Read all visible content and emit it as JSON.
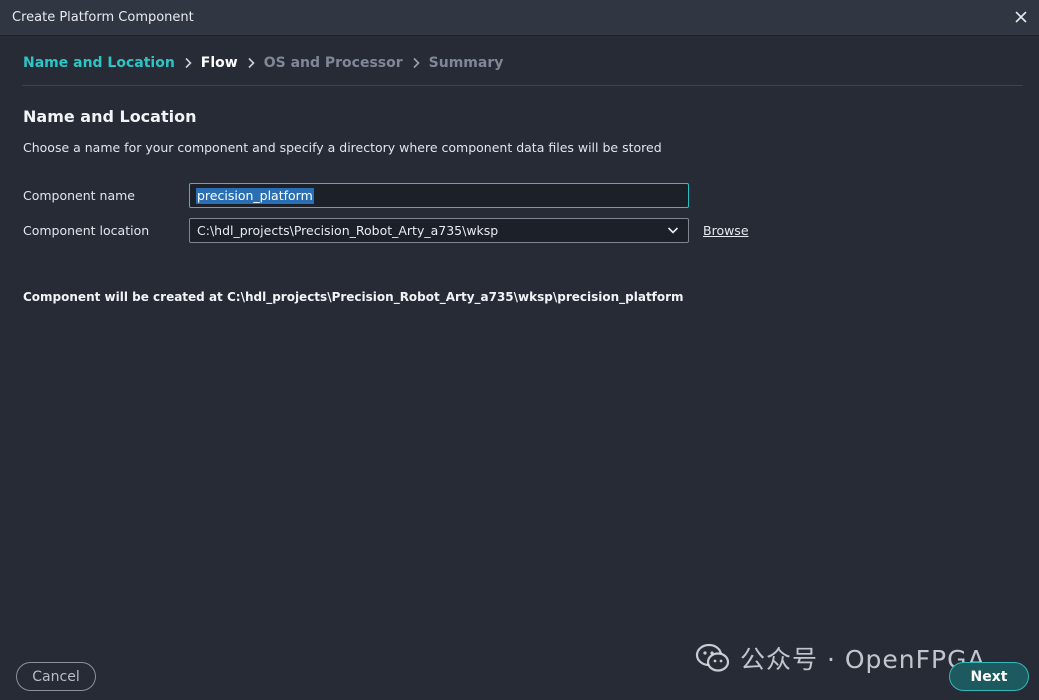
{
  "window": {
    "title": "Create Platform Component",
    "close_icon": "close-icon"
  },
  "steps": [
    {
      "label": "Name and Location",
      "state": "active"
    },
    {
      "label": "Flow",
      "state": "current"
    },
    {
      "label": "OS and Processor",
      "state": "pending"
    },
    {
      "label": "Summary",
      "state": "pending"
    }
  ],
  "page": {
    "heading": "Name and Location",
    "description": "Choose a name for your component and specify a directory where component data files will be stored"
  },
  "form": {
    "name_label": "Component name",
    "name_value": "precision_platform",
    "location_label": "Component location",
    "location_value": "C:\\hdl_projects\\Precision_Robot_Arty_a735\\wksp",
    "browse_label": "Browse"
  },
  "summary": "Component will be created at C:\\hdl_projects\\Precision_Robot_Arty_a735\\wksp\\precision_platform",
  "footer": {
    "cancel_label": "Cancel",
    "next_label": "Next"
  },
  "watermark": {
    "text": "公众号 · OpenFPGA",
    "icon": "wechat-icon"
  },
  "colors": {
    "accent": "#2ec4c4",
    "background": "#262b36",
    "titlebar": "#303642"
  }
}
